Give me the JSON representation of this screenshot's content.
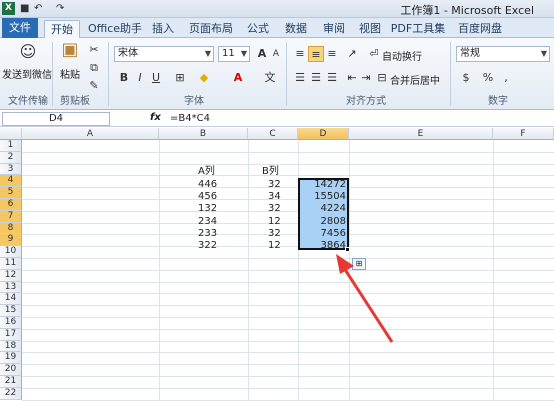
{
  "title_bar": {
    "title": "工作簿1 - Microsoft Excel",
    "app_icon": "X",
    "undo": "↶",
    "redo": "↷",
    "save": "■"
  },
  "tabs": [
    "文件",
    "开始",
    "Office助手",
    "插入",
    "页面布局",
    "公式",
    "数据",
    "审阅",
    "视图",
    "PDF工具集",
    "百度网盘"
  ],
  "ribbon": {
    "send_wechat": "发送到微信",
    "file_transfer": "文件传输",
    "paste": "粘贴",
    "clipboard": "剪贴板",
    "font_name": "宋体",
    "font_size": "11",
    "font_group": "字体",
    "bold": "B",
    "italic": "I",
    "underline": "U",
    "wrap_text": "自动换行",
    "merge_center": "合并后居中",
    "alignment_group": "对齐方式",
    "number_format": "常规",
    "number_group": "数字",
    "grow_font": "A",
    "shrink_font": "A",
    "percent": "%"
  },
  "formula_bar": {
    "name_box": "D4",
    "fx": "fx",
    "formula": "=B4*C4"
  },
  "columns": [
    "A",
    "B",
    "C",
    "D",
    "E",
    "F"
  ],
  "rows": [
    "1",
    "2",
    "3",
    "4",
    "5",
    "6",
    "7",
    "8",
    "9",
    "10",
    "11",
    "12",
    "13",
    "14",
    "15",
    "16",
    "17",
    "18",
    "19",
    "20",
    "21",
    "22"
  ],
  "cells": {
    "B3": "A列",
    "C3": "B列",
    "B4": "446",
    "C4": "32",
    "D4": "14272",
    "B5": "456",
    "C5": "34",
    "D5": "15504",
    "B6": "132",
    "C6": "32",
    "D6": "4224",
    "B7": "234",
    "C7": "12",
    "D7": "2808",
    "B8": "233",
    "C8": "32",
    "D8": "7456",
    "B9": "322",
    "C9": "12",
    "D9": "3864"
  },
  "colors": {
    "selection": "#a9d0f5",
    "arrow": "#e53935",
    "file_tab": "#2a6bb5"
  }
}
